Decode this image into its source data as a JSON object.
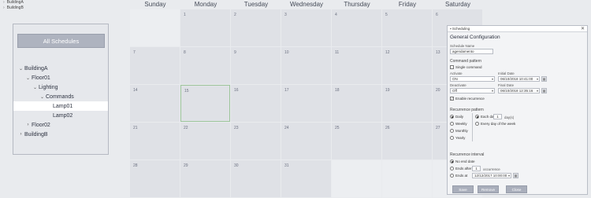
{
  "top_tree": [
    "BuildingA",
    "BuildingB"
  ],
  "left_panel": {
    "all_schedules": "All Schedules",
    "tree": [
      {
        "label": "BuildingA",
        "indent": 0,
        "chev": "⌄"
      },
      {
        "label": "Floor01",
        "indent": 1,
        "chev": "⌄"
      },
      {
        "label": "Lighting",
        "indent": 2,
        "chev": "⌄"
      },
      {
        "label": "Commands",
        "indent": 3,
        "chev": "⌄"
      },
      {
        "label": "Lamp01",
        "indent": 4,
        "chev": "",
        "selected": true
      },
      {
        "label": "Lamp02",
        "indent": 4,
        "chev": ""
      },
      {
        "label": "Floor02",
        "indent": 1,
        "chev": "›"
      },
      {
        "label": "BuildingB",
        "indent": 0,
        "chev": "›"
      }
    ]
  },
  "calendar": {
    "days": [
      "Sunday",
      "Monday",
      "Tuesday",
      "Wednesday",
      "Thursday",
      "Friday",
      "Saturday"
    ],
    "weeks": [
      [
        "",
        "1",
        "2",
        "3",
        "4",
        "5",
        "6"
      ],
      [
        "7",
        "8",
        "9",
        "10",
        "11",
        "12",
        "13"
      ],
      [
        "14",
        "15",
        "16",
        "17",
        "18",
        "19",
        "20"
      ],
      [
        "21",
        "22",
        "23",
        "24",
        "25",
        "26",
        "27"
      ],
      [
        "28",
        "29",
        "30",
        "31",
        "",
        "",
        ""
      ]
    ],
    "selected_day": "15"
  },
  "dialog": {
    "title": "Scheduling",
    "heading": "General Configuration",
    "schedule_name_label": "Schedule Name",
    "schedule_name_value": "agendamento",
    "command_pattern": "Command pattern",
    "single_command": "Single command",
    "activate_label": "Activate",
    "activate_value": "ON",
    "initial_date_label": "Initial Date",
    "initial_date_value": "06/10/2018 10:41:00",
    "deactivate_label": "Deactivate",
    "deactivate_value": "Off",
    "final_date_label": "Final Date",
    "final_date_value": "06/10/2018 12:35:16",
    "enable_recurrence": "Enable recurrence",
    "recurrence_pattern": "Recurrence pattern",
    "daily": "Daily",
    "weekly": "Weekly",
    "monthly": "Monthly",
    "yearly": "Yearly",
    "each_day": "Each day",
    "each_day_value": "1",
    "days_suffix": "day(s)",
    "every_day_week": "Every day of the week",
    "recurrence_interval": "Recurrence interval",
    "no_end_date": "No end date",
    "ends_after": "Ends after",
    "ends_after_value": "1",
    "occurrences": "occurrence",
    "ends_at": "Ends at",
    "ends_at_value": "12/12/2017 10:00:00",
    "save": "Save",
    "remove": "Remove",
    "close": "Close"
  }
}
